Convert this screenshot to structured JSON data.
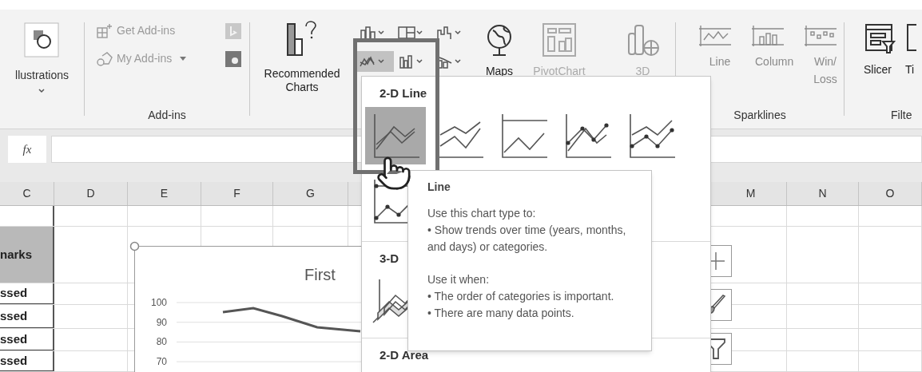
{
  "ribbon": {
    "illustrations": {
      "label": "llustrations"
    },
    "addins": {
      "items": [
        {
          "label": "Get Add-ins"
        },
        {
          "label": "My Add-ins"
        }
      ],
      "group_label": "Add-ins"
    },
    "recommended_charts": {
      "label": "Recommended Charts"
    },
    "charts": {
      "buttons": [
        {
          "kind": "column",
          "selected": false
        },
        {
          "kind": "hierarchy",
          "selected": false
        },
        {
          "kind": "waterfall",
          "selected": false
        },
        {
          "kind": "line",
          "selected": true
        },
        {
          "kind": "bar",
          "selected": false
        },
        {
          "kind": "combo",
          "selected": false
        }
      ],
      "maps": "Maps",
      "pivotchart": "PivotChart"
    },
    "map_3d": {
      "label": "3D"
    },
    "sparklines": {
      "items": [
        {
          "kind": "line",
          "label": "Line"
        },
        {
          "kind": "column",
          "label": "Column"
        },
        {
          "kind": "winloss",
          "label": "Win/ Loss"
        }
      ],
      "group_label": "Sparklines"
    },
    "filters": {
      "items": [
        {
          "kind": "slicer",
          "label": "Slicer"
        },
        {
          "kind": "timeline",
          "label": "Ti"
        }
      ],
      "group_label": "Filte"
    }
  },
  "formula_bar": {
    "fx": "fx"
  },
  "sheet": {
    "columns": [
      "C",
      "D",
      "E",
      "F",
      "G",
      "M",
      "N",
      "O"
    ],
    "column_c_cells": [
      {
        "text": "narks",
        "header": true
      },
      {
        "text": "ssed",
        "header": false
      },
      {
        "text": "ssed",
        "header": false
      },
      {
        "text": "ssed",
        "header": false
      },
      {
        "text": "ssed",
        "header": false
      }
    ]
  },
  "chart": {
    "title": "First",
    "y_axis_labels": [
      "100",
      "90",
      "80",
      "70"
    ]
  },
  "dropdown": {
    "sections": [
      {
        "title": "2-D Line",
        "items": [
          {
            "kind": "line",
            "selected": true
          },
          {
            "kind": "stacked_line",
            "selected": false
          },
          {
            "kind": "percent_line",
            "selected": false
          },
          {
            "kind": "line_markers",
            "selected": false
          },
          {
            "kind": "stacked_markers",
            "selected": false
          },
          {
            "kind": "percent_markers",
            "selected": false
          }
        ]
      },
      {
        "title": "3-D",
        "items": [
          {
            "kind": "line_3d",
            "selected": false
          }
        ]
      },
      {
        "title": "2-D Area"
      }
    ]
  },
  "tooltip": {
    "title": "Line",
    "paragraphs": [
      [
        "Use this chart type to:",
        "• Show trends over time (years, months, and days) or categories."
      ],
      [
        "Use it when:",
        "• The order of categories is important.",
        "• There are many data points."
      ]
    ]
  }
}
